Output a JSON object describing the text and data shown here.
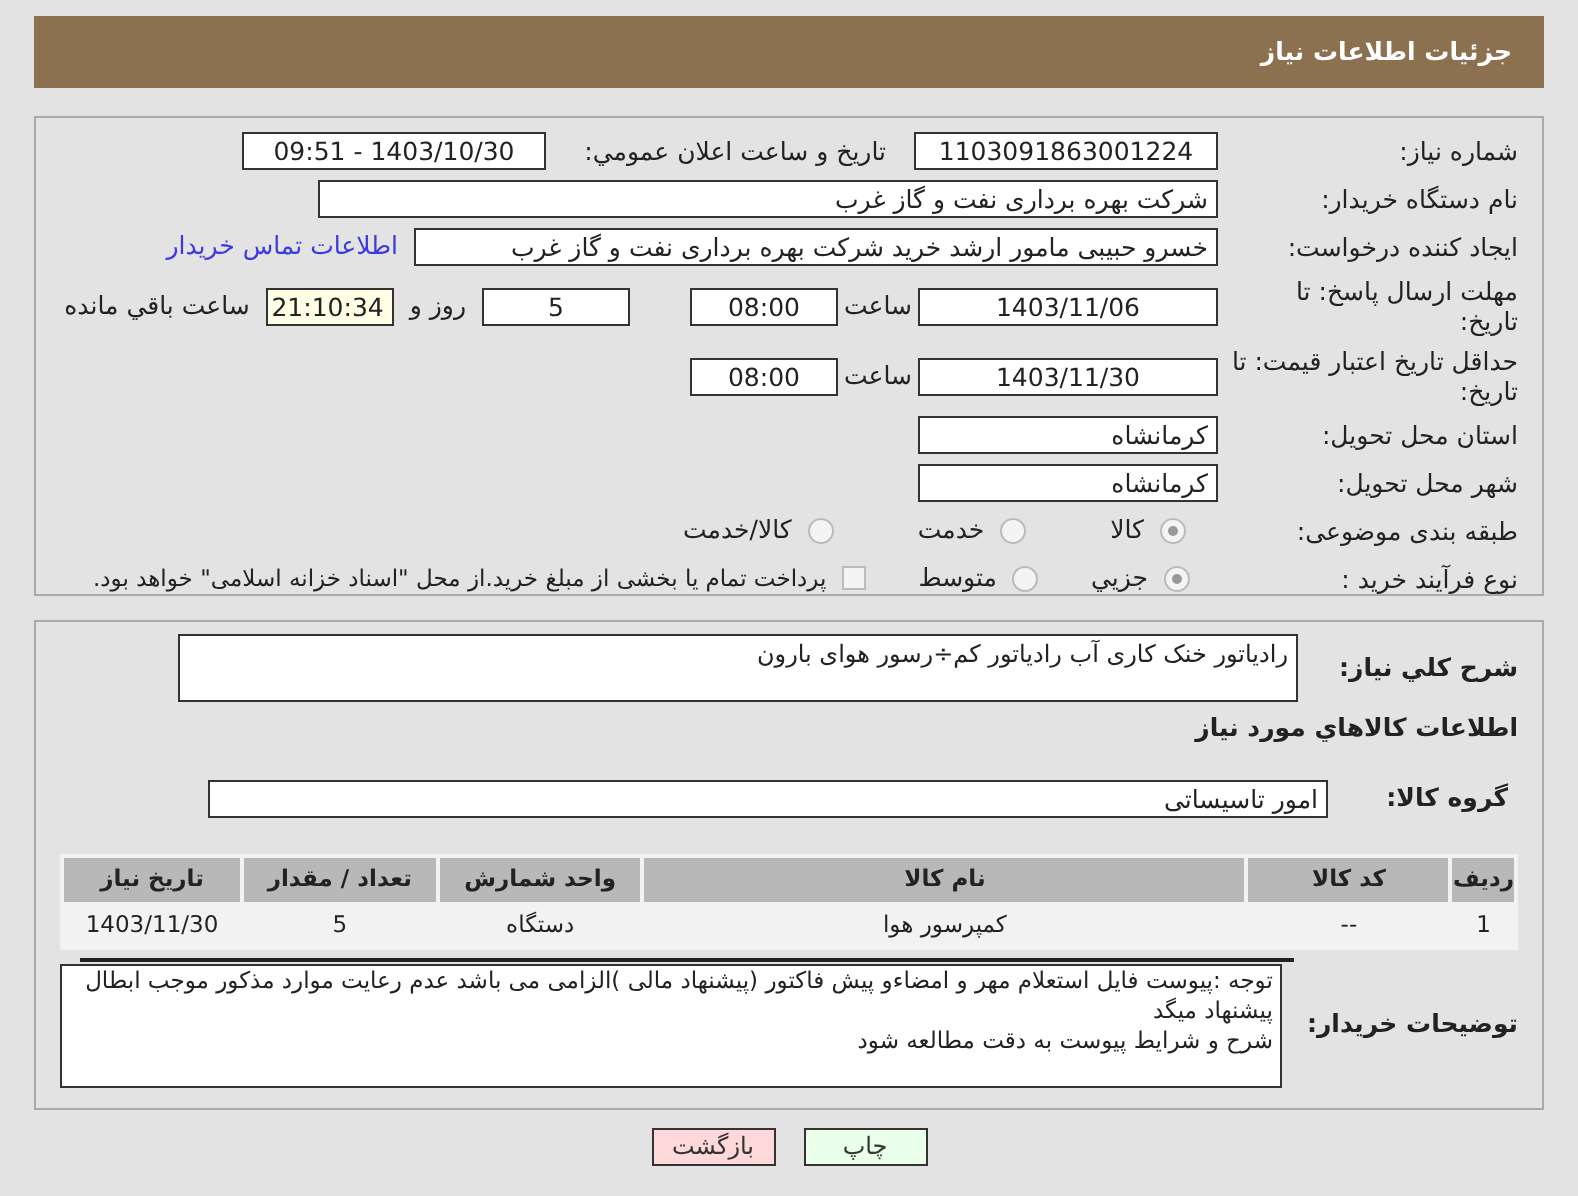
{
  "header": {
    "title": "جزئیات اطلاعات نیاز"
  },
  "need_number": {
    "label": "شماره نیاز:",
    "value": "1103091863001224"
  },
  "announce": {
    "label": "تاریخ و ساعت اعلان عمومي:",
    "value": "1403/10/30 - 09:51"
  },
  "buyer": {
    "label": "نام دستگاه خریدار:",
    "value": "شرکت بهره برداری نفت و گاز غرب"
  },
  "creator": {
    "label": "ایجاد کننده درخواست:",
    "value": "خسرو حبیبی مامور ارشد خرید شرکت بهره برداری نفت و گاز غرب",
    "link": "اطلاعات تماس خریدار"
  },
  "deadline": {
    "label": "مهلت ارسال پاسخ: تا تاریخ:",
    "date": "1403/11/06",
    "time_label": "ساعت",
    "time": "08:00",
    "days": "5",
    "days_label": "روز و",
    "remaining": "21:10:34",
    "remaining_label": "ساعت باقي مانده"
  },
  "validity": {
    "label": "حداقل تاریخ اعتبار قیمت: تا تاریخ:",
    "date": "1403/11/30",
    "time_label": "ساعت",
    "time": "08:00"
  },
  "province": {
    "label": "استان محل تحویل:",
    "value": "کرمانشاه"
  },
  "city": {
    "label": "شهر محل تحویل:",
    "value": "کرمانشاه"
  },
  "category": {
    "label": "طبقه بندی موضوعی:",
    "options": [
      {
        "label": "کالا",
        "selected": true
      },
      {
        "label": "خدمت",
        "selected": false
      },
      {
        "label": "کالا/خدمت",
        "selected": false
      }
    ]
  },
  "process": {
    "label": "نوع فرآیند خرید :",
    "options": [
      {
        "label": "جزیي",
        "selected": true
      },
      {
        "label": "متوسط",
        "selected": false
      }
    ],
    "treasury": {
      "label": "پرداخت تمام یا بخشی از مبلغ خرید.از محل \"اسناد خزانه اسلامی\" خواهد بود.",
      "checked": false
    }
  },
  "description": {
    "label": "شرح کلي نیاز:",
    "value": "رادیاتور خنک کاری آب رادیاتور کم÷رسور هوای بارون"
  },
  "goods_heading": "اطلاعات کالاهاي مورد نیاز",
  "goods_group": {
    "label": "گروه کالا:",
    "value": "امور تاسیساتی"
  },
  "table": {
    "columns": [
      "ردیف",
      "کد کالا",
      "نام کالا",
      "واحد شمارش",
      "تعداد / مقدار",
      "تاریخ نیاز"
    ],
    "rows": [
      [
        "1",
        "--",
        "کمپرسور هوا",
        "دستگاه",
        "5",
        "1403/11/30"
      ]
    ]
  },
  "buyer_notes": {
    "label": "توضیحات خریدار:",
    "lines": [
      "توجه :پیوست فایل استعلام مهر و امضاءو پیش فاکتور (پیشنهاد مالی )الزامی می باشد عدم رعایت موارد مذکور موجب ابطال پیشنهاد میگد",
      "شرح و شرایط پیوست به دقت مطالعه شود"
    ]
  },
  "buttons": [
    {
      "label": "چاپ",
      "kind": "print"
    },
    {
      "label": "بازگشت",
      "kind": "back"
    }
  ]
}
